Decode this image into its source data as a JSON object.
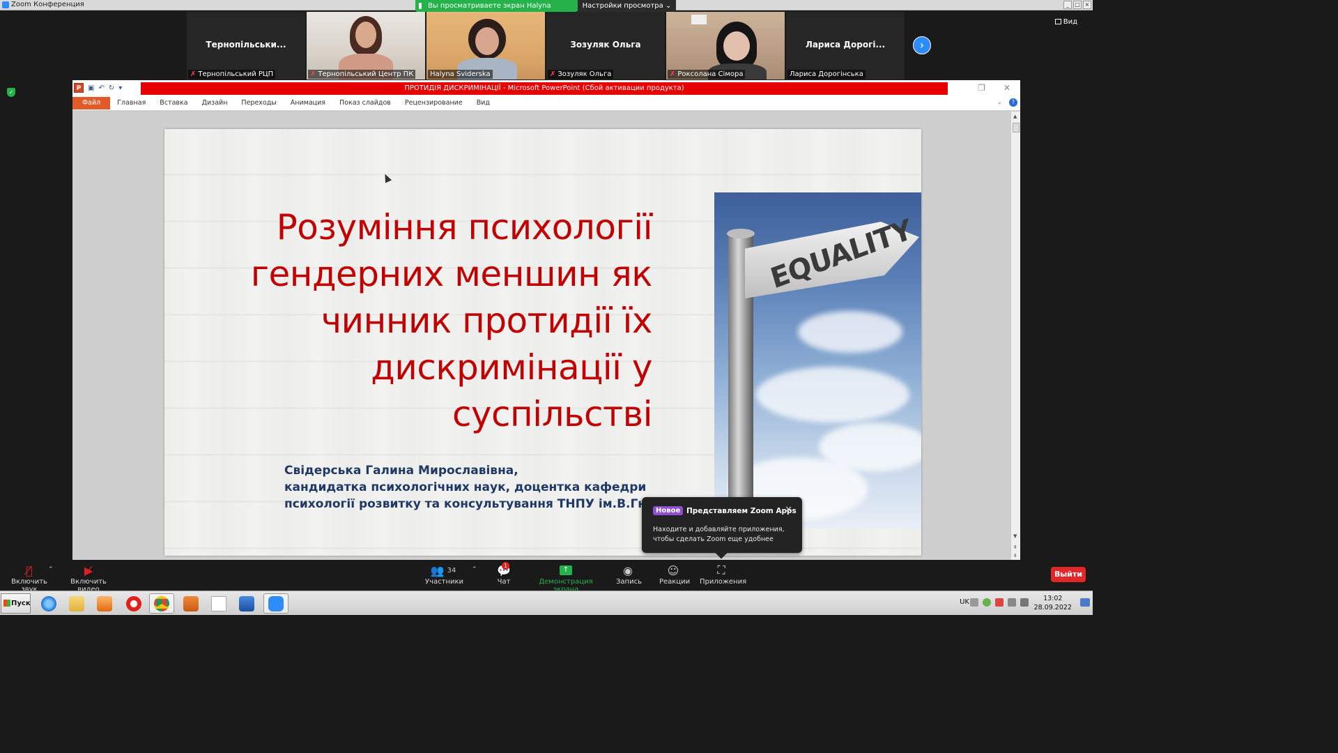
{
  "window": {
    "title": "Zoom Конференция",
    "share_banner": "Вы просматриваете экран Halyna Sviderska",
    "view_settings": "Настройки просмотра ⌄",
    "view_toggle": "Вид"
  },
  "gallery": {
    "tiles": [
      {
        "big_name": "Тернопільськи...",
        "label": "Тернопільський РЦП",
        "muted": true,
        "has_video": false
      },
      {
        "big_name": "",
        "label": "Тернопільський Центр ПК",
        "muted": true,
        "has_video": true
      },
      {
        "big_name": "",
        "label": "Halyna Sviderska",
        "muted": false,
        "has_video": true
      },
      {
        "big_name": "Зозуляк Ольга",
        "label": "Зозуляк Ольга",
        "muted": true,
        "has_video": false
      },
      {
        "big_name": "",
        "label": "Роксолана Сімора",
        "muted": true,
        "has_video": true
      },
      {
        "big_name": "Лариса  Дорогі...",
        "label": "Лариса Дорогінська",
        "muted": false,
        "has_video": false
      }
    ],
    "next_icon": "chevron-right-icon"
  },
  "ppt": {
    "title": "ПРОТИДІЯ ДИСКРИМІНАЦІЇ  -  Microsoft PowerPoint (Сбой активации продукта)",
    "file_tab": "Файл",
    "tabs": [
      "Главная",
      "Вставка",
      "Дизайн",
      "Переходы",
      "Анимация",
      "Показ слайдов",
      "Рецензирование",
      "Вид"
    ]
  },
  "slide": {
    "title_lines": [
      "Розуміння психології",
      "гендерних меншин як",
      "чинник протидії їх",
      "дискримінації у суспільстві"
    ],
    "author_lines": [
      "Свідерська Галина Мирославівна,",
      "кандидатка психологічних наук, доцентка кафедри",
      "психології розвитку та консультування ТНПУ ім.В.Гнатюка"
    ],
    "sign_text": "EQUALITY"
  },
  "popup": {
    "badge": "Новое",
    "title": "Представляем Zoom Apps",
    "body": "Находите и добавляйте приложения, чтобы сделать Zoom еще удобнее"
  },
  "toolbar": {
    "audio": "Включить звук",
    "video": "Включить видео",
    "participants": "Участники",
    "participants_count": "34",
    "chat": "Чат",
    "chat_badge": "1",
    "share": "Демонстрация экрана",
    "record": "Запись",
    "reactions": "Реакции",
    "apps": "Приложения",
    "leave": "Выйти"
  },
  "taskbar": {
    "start": "Пуск",
    "lang": "UK",
    "time": "13:02",
    "date": "28.09.2022"
  },
  "colors": {
    "title_red": "#c00000",
    "author_blue": "#1f3864",
    "zoom_green": "#25b24a",
    "zoom_blue": "#2d8cff",
    "leave_red": "#e02828"
  }
}
